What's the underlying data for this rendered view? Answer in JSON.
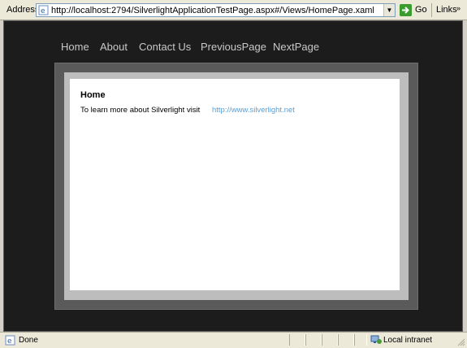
{
  "address_bar": {
    "label": "Address",
    "url": "http://localhost:2794/SilverlightApplicationTestPage.aspx#/Views/HomePage.xaml",
    "go_label": "Go",
    "links_label": "Links"
  },
  "nav": {
    "items": [
      {
        "label": "Home"
      },
      {
        "label": "About"
      },
      {
        "label": "Contact Us"
      },
      {
        "label": "PreviousPage"
      },
      {
        "label": "NextPage"
      }
    ]
  },
  "page": {
    "title": "Home",
    "text": "To learn more about Silverlight visit",
    "link": "http://www.silverlight.net"
  },
  "status_bar": {
    "status": "Done",
    "zone": "Local intranet"
  },
  "colors": {
    "background": "#1c1c1c",
    "nav_text": "#c8c8c8",
    "link": "#5aa0d8"
  }
}
